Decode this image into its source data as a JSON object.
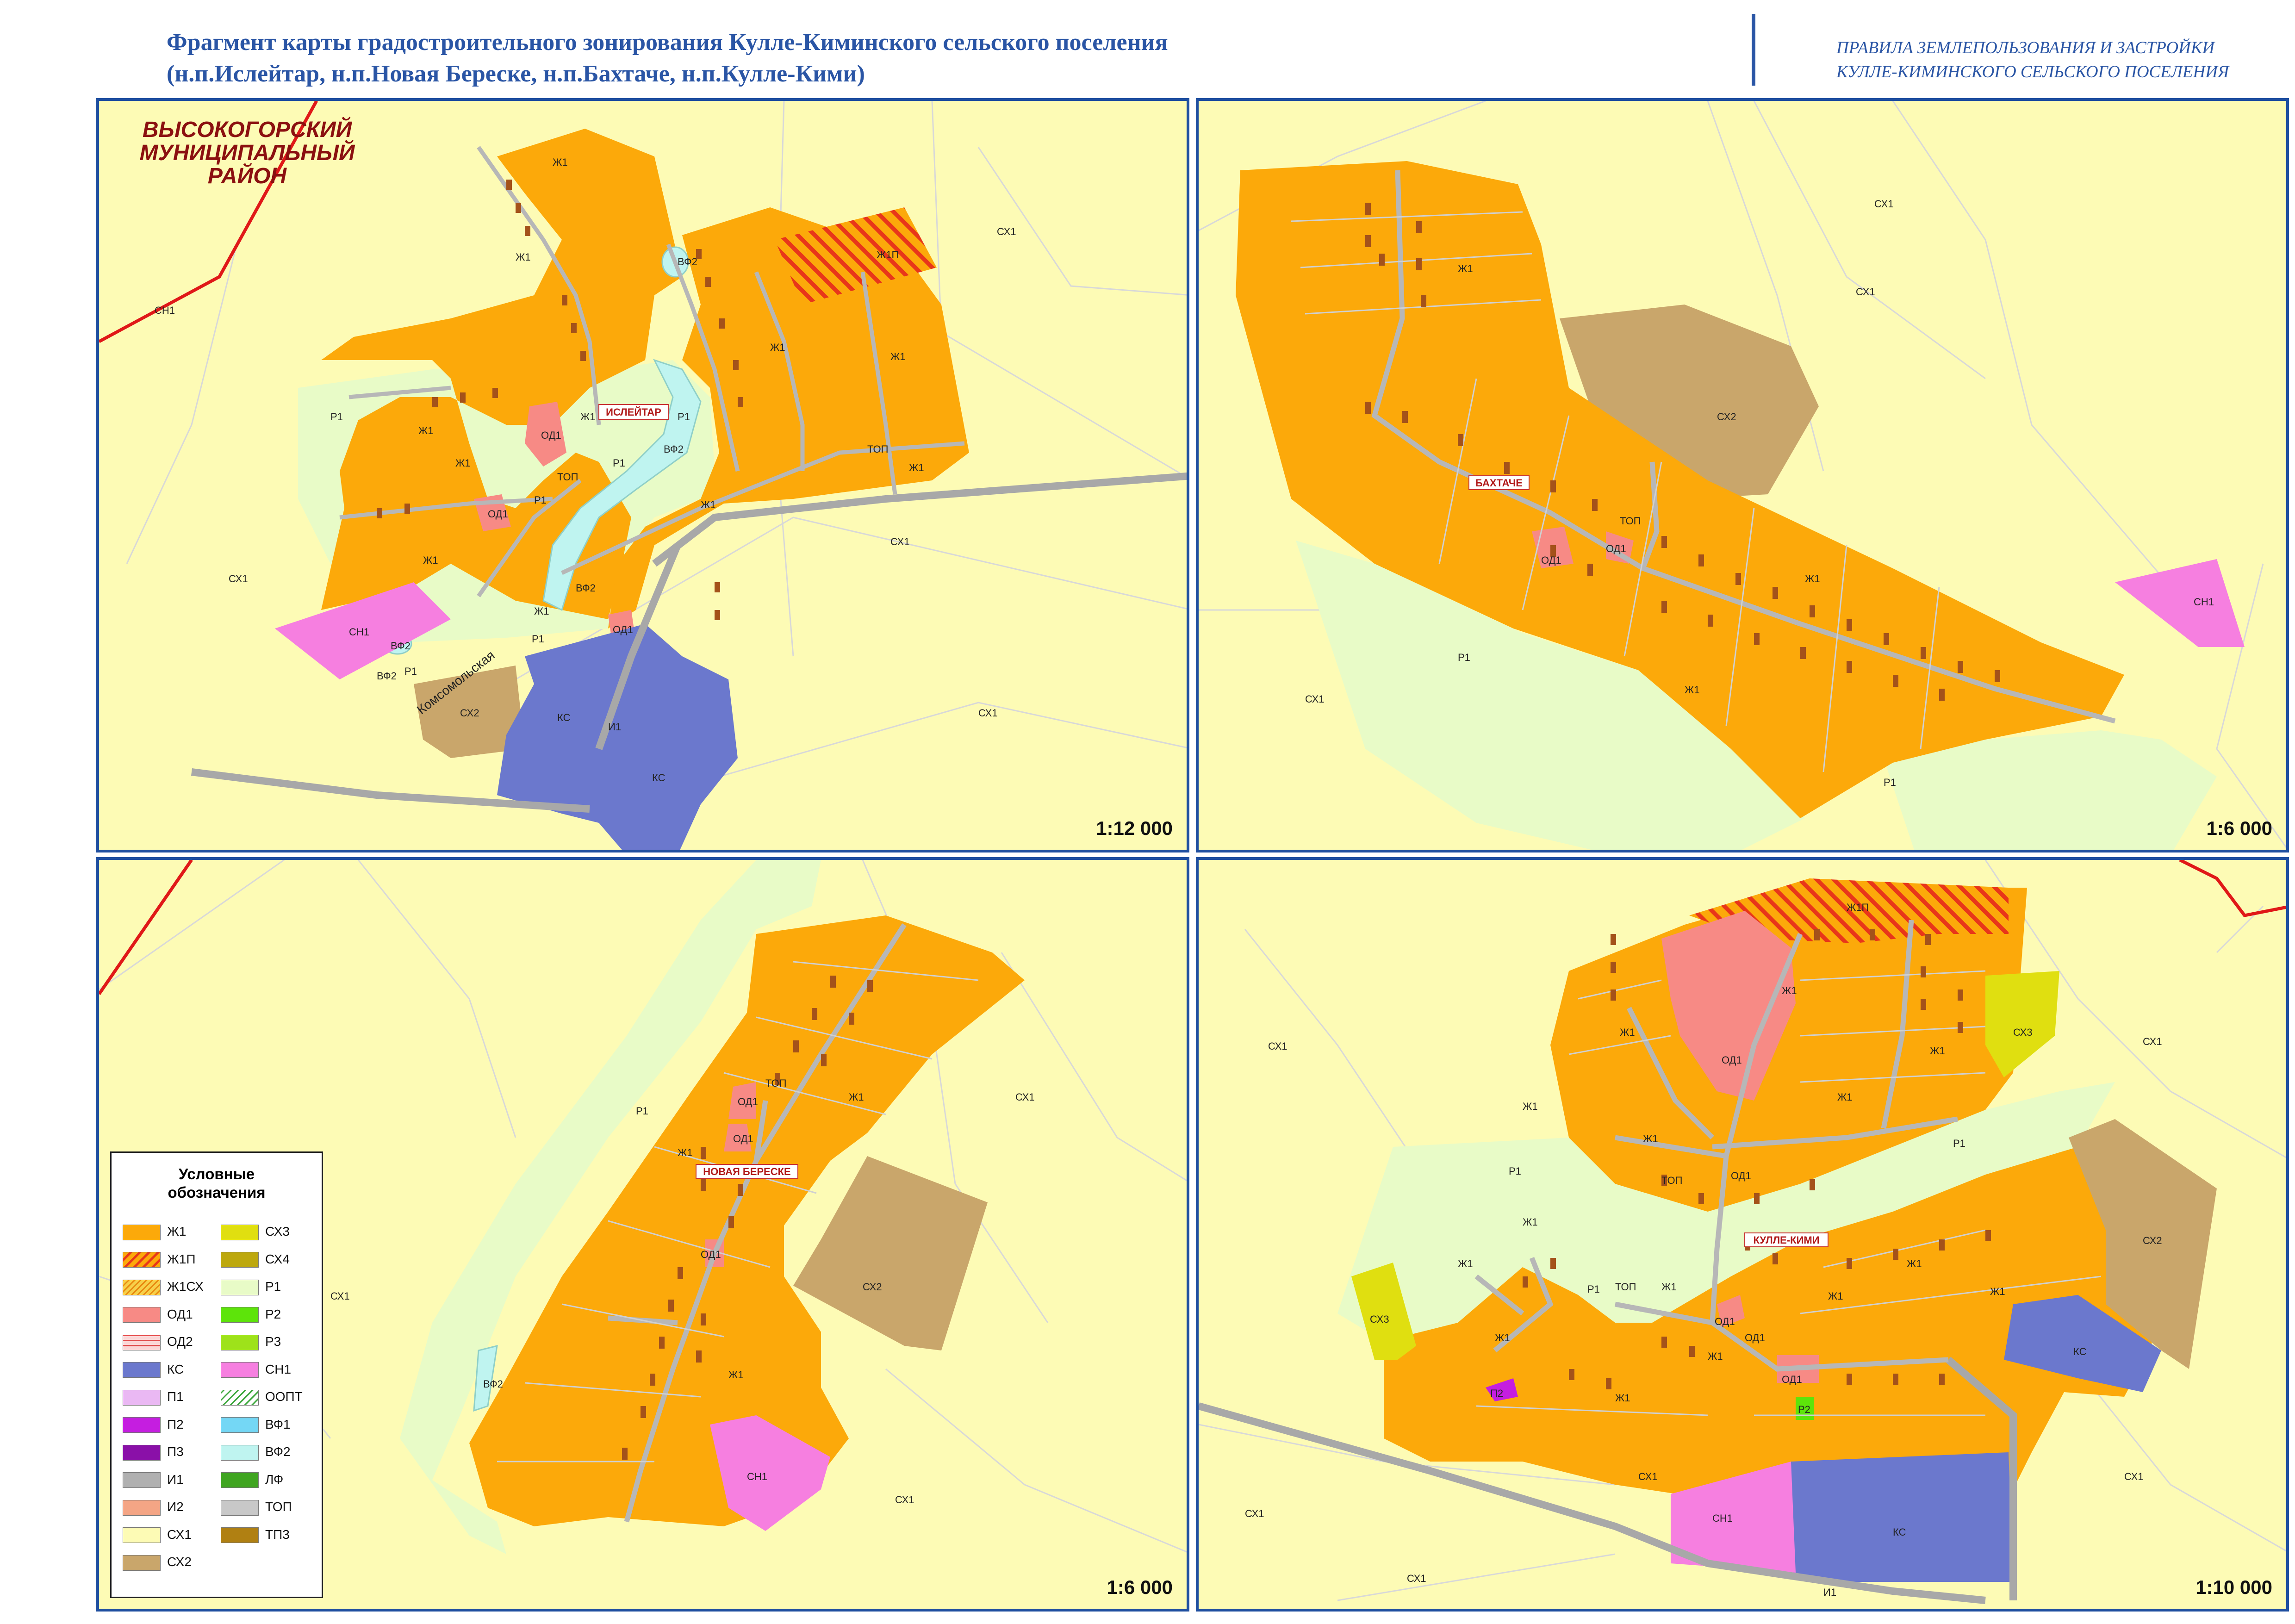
{
  "header": {
    "title_line1": "Фрагмент карты градостроительного зонирования Кулле-Киминского сельского поселения",
    "title_line2": "(н.п.Ислейтар, н.п.Новая Береске, н.п.Бахтаче, н.п.Кулле-Кими)",
    "right_line1": "ПРАВИЛА ЗЕМЛЕПОЛЬЗОВАНИЯ И ЗАСТРОЙКИ",
    "right_line2": "КУЛЛЕ-КИМИНСКОГО СЕЛЬСКОГО ПОСЕЛЕНИЯ"
  },
  "colors": {
    "zh1": "#fca90a",
    "od1": "#f78a85",
    "ks": "#6b78cd",
    "sn1": "#f67fe0",
    "sx1": "#fdfbb5",
    "sx2": "#c9a66b",
    "sx3": "#e0df10",
    "r1": "#e8fbc7",
    "vf2": "#bff4f0",
    "road": "#b7b7b7",
    "border": "#e01818",
    "p2": "#c51ee0",
    "r2": "#5de40a"
  },
  "maps": {
    "isleitar": {
      "scale": "1:12 000",
      "district": [
        "ВЫСОКОГОРСКИЙ",
        "МУНИЦИПАЛЬНЫЙ",
        "РАЙОН"
      ],
      "settlement": "ИСЛЕЙТАР",
      "street": "Комсомольская",
      "labels": {
        "zh1": "Ж1",
        "zh1p": "Ж1П",
        "sx1": "СХ1",
        "sx2": "СХ2",
        "sn1": "СН1",
        "od1": "ОД1",
        "r1": "Р1",
        "vf2": "ВФ2",
        "ks": "КС",
        "i1": "И1",
        "top": "ТОП"
      }
    },
    "bakhtache": {
      "scale": "1:6 000",
      "settlement": "БАХТАЧЕ",
      "labels": {
        "zh1": "Ж1",
        "sx1": "СХ1",
        "sx2": "СХ2",
        "sn1": "СН1",
        "od1": "ОД1",
        "r1": "Р1",
        "top": "ТОП"
      }
    },
    "novaya_bereske": {
      "scale": "1:6 000",
      "settlement": "НОВАЯ БЕРЕСКЕ",
      "labels": {
        "zh1": "Ж1",
        "sx1": "СХ1",
        "sx2": "СХ2",
        "sn1": "СН1",
        "od1": "ОД1",
        "r1": "Р1",
        "vf2": "ВФ2",
        "top": "ТОП"
      }
    },
    "kulle_kimi": {
      "scale": "1:10 000",
      "settlement": "КУЛЛЕ-КИМИ",
      "labels": {
        "zh1": "Ж1",
        "zh1p": "Ж1П",
        "sx1": "СХ1",
        "sx2": "СХ2",
        "sx3": "СХ3",
        "sn1": "СН1",
        "od1": "ОД1",
        "r1": "Р1",
        "r2": "Р2",
        "p2": "П2",
        "ks": "КС",
        "i1": "И1",
        "top": "ТОП"
      }
    }
  },
  "legend": {
    "title_line1": "Условные",
    "title_line2": "обозначения",
    "items": [
      {
        "code": "Ж1",
        "color": "#fca90a",
        "pattern": "solid"
      },
      {
        "code": "Ж1П",
        "color": "#fca90a",
        "pattern": "hatch-red"
      },
      {
        "code": "Ж1СХ",
        "color": "#f6d04a",
        "pattern": "hatch-orange"
      },
      {
        "code": "ОД1",
        "color": "#f78a85",
        "pattern": "solid"
      },
      {
        "code": "ОД2",
        "color": "#fbd6d6",
        "pattern": "hstripe"
      },
      {
        "code": "КС",
        "color": "#6b78cd",
        "pattern": "solid"
      },
      {
        "code": "П1",
        "color": "#eab8f3",
        "pattern": "solid"
      },
      {
        "code": "П2",
        "color": "#c51ee0",
        "pattern": "solid"
      },
      {
        "code": "П3",
        "color": "#8a10a8",
        "pattern": "solid"
      },
      {
        "code": "И1",
        "color": "#b0b0b0",
        "pattern": "solid"
      },
      {
        "code": "И2",
        "color": "#f4a585",
        "pattern": "solid"
      },
      {
        "code": "СХ1",
        "color": "#fdfbb5",
        "pattern": "solid"
      },
      {
        "code": "СХ2",
        "color": "#c9a66b",
        "pattern": "solid"
      },
      {
        "code": "СХ3",
        "color": "#e0df10",
        "pattern": "solid"
      },
      {
        "code": "СХ4",
        "color": "#bda80e",
        "pattern": "solid"
      },
      {
        "code": "Р1",
        "color": "#e8fbc7",
        "pattern": "solid"
      },
      {
        "code": "Р2",
        "color": "#5de40a",
        "pattern": "solid"
      },
      {
        "code": "Р3",
        "color": "#9ee21a",
        "pattern": "solid"
      },
      {
        "code": "СН1",
        "color": "#f67fe0",
        "pattern": "solid"
      },
      {
        "code": "ООПТ",
        "color": "#ffffff",
        "pattern": "hatch-green"
      },
      {
        "code": "ВФ1",
        "color": "#74d7f5",
        "pattern": "solid"
      },
      {
        "code": "ВФ2",
        "color": "#bff4f0",
        "pattern": "solid"
      },
      {
        "code": "ЛФ",
        "color": "#3fa520",
        "pattern": "solid"
      },
      {
        "code": "ТОП",
        "color": "#c8c8c8",
        "pattern": "solid"
      },
      {
        "code": "ТП3",
        "color": "#b08012",
        "pattern": "solid"
      }
    ]
  }
}
